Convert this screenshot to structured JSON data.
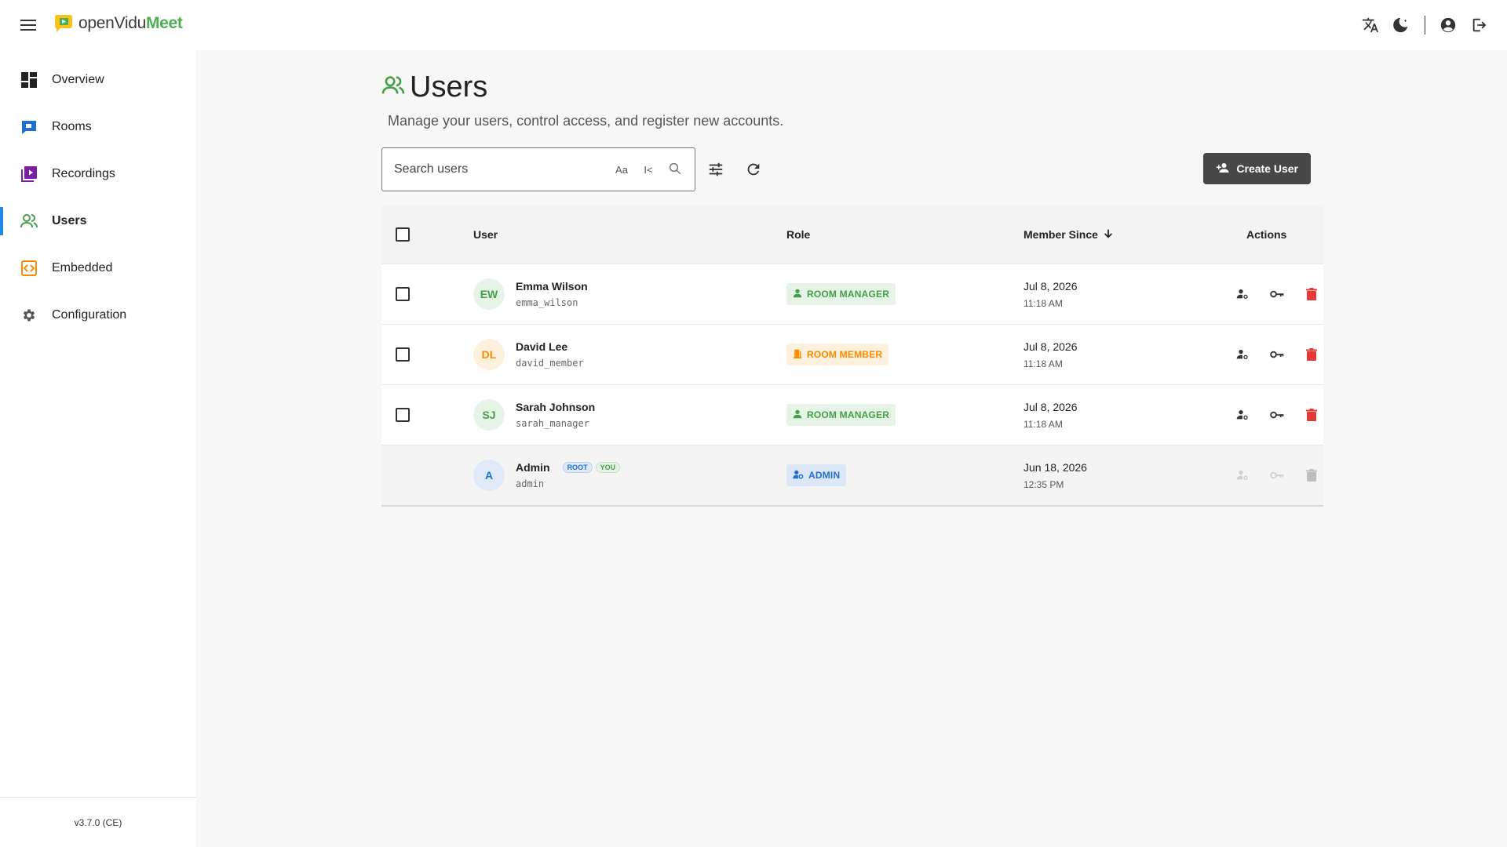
{
  "app": {
    "logo_part1": "openVidu",
    "logo_part2": "Meet",
    "version": "v3.7.0 (CE)"
  },
  "sidebar": {
    "items": [
      {
        "label": "Overview",
        "icon": "dashboard-icon"
      },
      {
        "label": "Rooms",
        "icon": "room-icon"
      },
      {
        "label": "Recordings",
        "icon": "recordings-icon"
      },
      {
        "label": "Users",
        "icon": "users-icon",
        "active": true
      },
      {
        "label": "Embedded",
        "icon": "embedded-icon"
      },
      {
        "label": "Configuration",
        "icon": "gear-icon"
      }
    ]
  },
  "page": {
    "title": "Users",
    "subtitle": "Manage your users, control access, and register new accounts."
  },
  "search": {
    "placeholder": "Search users",
    "case_label": "Aa",
    "prefix_label": "I<"
  },
  "toolbar": {
    "create_label": "Create User"
  },
  "table": {
    "columns": {
      "user": "User",
      "role": "Role",
      "member_since": "Member Since",
      "actions": "Actions"
    },
    "rows": [
      {
        "initials": "EW",
        "name": "Emma Wilson",
        "username": "emma_wilson",
        "role": "ROOM MANAGER",
        "date": "Jul 8, 2026",
        "time": "11:18 AM"
      },
      {
        "initials": "DL",
        "name": "David Lee",
        "username": "david_member",
        "role": "ROOM MEMBER",
        "date": "Jul 8, 2026",
        "time": "11:18 AM"
      },
      {
        "initials": "SJ",
        "name": "Sarah Johnson",
        "username": "sarah_manager",
        "role": "ROOM MANAGER",
        "date": "Jul 8, 2026",
        "time": "11:18 AM"
      },
      {
        "initials": "A",
        "name": "Admin",
        "username": "admin",
        "badge_root": "ROOT",
        "badge_you": "YOU",
        "role": "ADMIN",
        "date": "Jun 18, 2026",
        "time": "12:35 PM"
      }
    ]
  },
  "colors": {
    "accent_blue": "#1e88e5",
    "manager_green": "#43a047",
    "member_orange": "#fb8c00",
    "admin_blue": "#1e6fd0",
    "delete_red": "#e53935",
    "button_dark": "#474747"
  }
}
